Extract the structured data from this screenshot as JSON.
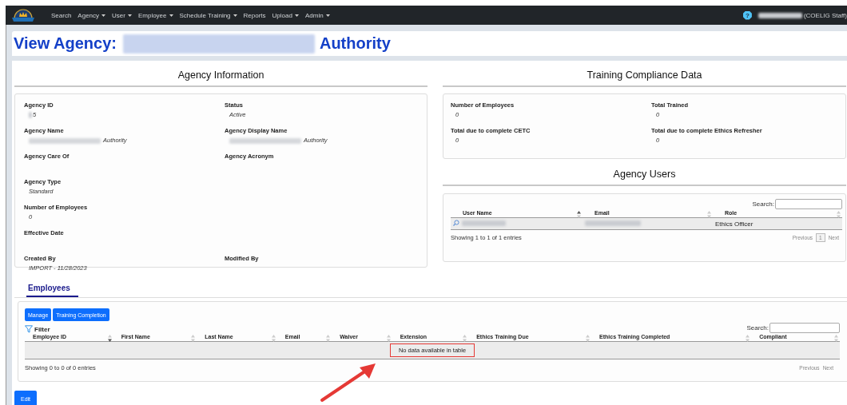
{
  "nav": {
    "items": [
      {
        "label": "Search",
        "dropdown": false
      },
      {
        "label": "Agency",
        "dropdown": true
      },
      {
        "label": "User",
        "dropdown": true
      },
      {
        "label": "Employee",
        "dropdown": true
      },
      {
        "label": "Schedule Training",
        "dropdown": true
      },
      {
        "label": "Reports",
        "dropdown": false
      },
      {
        "label": "Upload",
        "dropdown": true
      },
      {
        "label": "Admin",
        "dropdown": true
      }
    ],
    "help": "?",
    "user_name_redacted": true,
    "user_role": "(COELIG Staff)"
  },
  "page_title": {
    "prefix": "View Agency:",
    "name_redacted": true,
    "suffix": "Authority"
  },
  "agency_information": {
    "title": "Agency Information",
    "rows": [
      {
        "left": {
          "label": "Agency ID",
          "value": "5",
          "redacted": true
        },
        "right": {
          "label": "Status",
          "value": "Active"
        }
      },
      {
        "left": {
          "label": "Agency Name",
          "value": "Authority",
          "redacted": true
        },
        "right": {
          "label": "Agency Display Name",
          "value": "Authority",
          "redacted": true
        }
      },
      {
        "left": {
          "label": "Agency Care Of"
        },
        "right": {
          "label": "Agency Acronym"
        }
      },
      {
        "left": {
          "label": "Agency Type",
          "value": "Standard"
        }
      },
      {
        "left": {
          "label": "Number of Employees",
          "value": "0"
        }
      },
      {
        "left": {
          "label": "Effective Date"
        }
      },
      {
        "left": {
          "label": "Created By",
          "value": "IMPORT - 11/28/2023"
        },
        "right": {
          "label": "Modified By"
        }
      }
    ]
  },
  "training_compliance": {
    "title": "Training Compliance Data",
    "rows": [
      {
        "left": {
          "label": "Number of Employees",
          "value": "0"
        },
        "right": {
          "label": "Total Trained",
          "value": "0"
        }
      },
      {
        "left": {
          "label": "Total due to complete CETC",
          "value": "0"
        },
        "right": {
          "label": "Total due to complete Ethics Refresher",
          "value": "0"
        }
      }
    ]
  },
  "agency_users": {
    "title": "Agency Users",
    "search_label": "Search:",
    "columns": [
      {
        "label": "User Name",
        "sorted": true,
        "ascending": true
      },
      {
        "label": "Email",
        "sorted": false
      },
      {
        "label": "Role",
        "sorted": false
      }
    ],
    "rows": [
      {
        "user_name_redacted": true,
        "email_redacted": true,
        "role": "Ethics Officer"
      }
    ],
    "info": "Showing 1 to 1 of 1 entries",
    "pagination": [
      {
        "label": "Previous",
        "kind": "link",
        "selected": false
      },
      {
        "label": "1",
        "kind": "page",
        "selected": true
      },
      {
        "label": "Next",
        "kind": "link",
        "selected": false
      }
    ]
  },
  "employees": {
    "tabs": [
      {
        "label": "Employees",
        "selected": true
      }
    ],
    "buttons": [
      "Manage",
      "Training Completion"
    ],
    "filter": "Filter",
    "search_label": "Search:",
    "columns": [
      {
        "label": "Employee ID",
        "sorted": true,
        "ascending": false
      },
      {
        "label": "First Name",
        "sorted": false
      },
      {
        "label": "Last Name",
        "sorted": false
      },
      {
        "label": "Email",
        "sorted": false
      },
      {
        "label": "Waiver",
        "sorted": false
      },
      {
        "label": "Extension",
        "sorted": false
      },
      {
        "label": "Ethics Training Due",
        "sorted": false
      },
      {
        "label": "Ethics Training Completed",
        "sorted": false
      },
      {
        "label": "Compliant",
        "sorted": false
      }
    ],
    "empty_message": "No data available in table",
    "empty_highlighted": true,
    "info": "Showing 0 to 0 of 0 entries",
    "pagination": [
      {
        "label": "Previous"
      },
      {
        "label": "Next"
      }
    ]
  },
  "edit_button": "Edit"
}
